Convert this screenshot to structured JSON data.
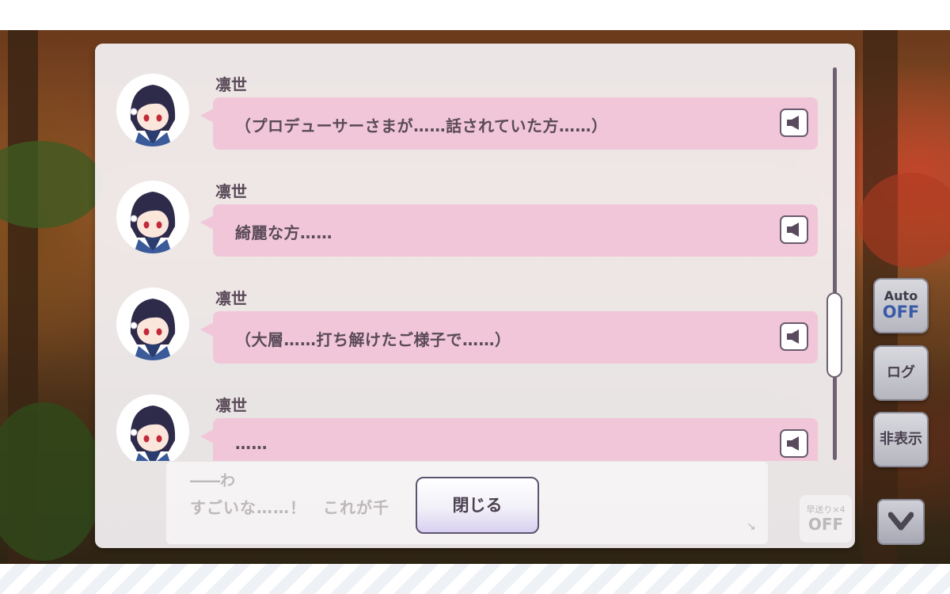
{
  "log": {
    "entries": [
      {
        "speaker": "凛世",
        "text": "（プロデューサーさまが……話されていた方……）"
      },
      {
        "speaker": "凛世",
        "text": "綺麗な方……"
      },
      {
        "speaker": "凛世",
        "text": "（大層……打ち解けたご様子で……）"
      },
      {
        "speaker": "凛世",
        "text": "……"
      }
    ],
    "voice_icon": "speaker-icon",
    "close_label": "閉じる"
  },
  "background_dialog": {
    "line1": "――わ",
    "line2": "すごいな……！　これが千",
    "arrow": "↘"
  },
  "fast_forward": {
    "line1": "早送り×4",
    "line2": "OFF"
  },
  "side_controls": {
    "auto_label": "Auto",
    "auto_state": "OFF",
    "log_label": "ログ",
    "hide_label": "非表示",
    "down_icon": "chevron-down-icon"
  },
  "colors": {
    "bubble": "#f0c6d8",
    "text": "#5a4a58",
    "auto_off": "#3a5aa8",
    "panel": "#f5f2f4"
  }
}
